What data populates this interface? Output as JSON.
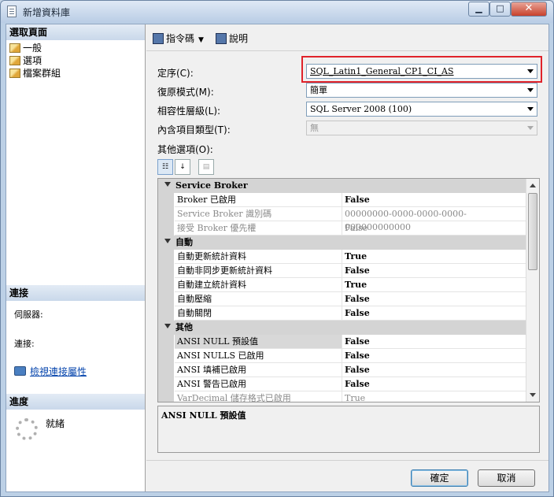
{
  "window": {
    "title": "新增資料庫"
  },
  "left": {
    "select_page_header": "選取頁面",
    "pages": [
      {
        "label": "一般"
      },
      {
        "label": "選項"
      },
      {
        "label": "檔案群組"
      }
    ],
    "connection_header": "連接",
    "server_label": "伺服器:",
    "connection_label": "連接:",
    "view_conn_link": "檢視連接屬性",
    "progress_header": "進度",
    "progress_status": "就緒"
  },
  "toolbar": {
    "script_label": "指令碼",
    "help_label": "說明"
  },
  "form": {
    "collation_label": "定序(C):",
    "collation_value": "SQL_Latin1_General_CP1_CI_AS",
    "recovery_label": "復原模式(M):",
    "recovery_value": "簡單",
    "compat_label": "相容性層級(L):",
    "compat_value": "SQL Server 2008 (100)",
    "containment_label": "內含項目類型(T):",
    "containment_value": "無",
    "other_label": "其他選項(O):"
  },
  "grid": {
    "rows": [
      {
        "type": "cat",
        "name": "Service Broker"
      },
      {
        "type": "prop",
        "name": "Broker 已啟用",
        "value": "False",
        "bold": true
      },
      {
        "type": "prop",
        "name": "Service Broker 識別碼",
        "value": "00000000-0000-0000-0000-000000000000",
        "dim": true
      },
      {
        "type": "prop",
        "name": "接受 Broker 優先權",
        "value": "False",
        "dim": true
      },
      {
        "type": "cat",
        "name": "自動"
      },
      {
        "type": "prop",
        "name": "自動更新統計資料",
        "value": "True",
        "bold": true
      },
      {
        "type": "prop",
        "name": "自動非同步更新統計資料",
        "value": "False",
        "bold": true
      },
      {
        "type": "prop",
        "name": "自動建立統計資料",
        "value": "True",
        "bold": true
      },
      {
        "type": "prop",
        "name": "自動壓縮",
        "value": "False",
        "bold": true
      },
      {
        "type": "prop",
        "name": "自動關閉",
        "value": "False",
        "bold": true
      },
      {
        "type": "cat",
        "name": "其他"
      },
      {
        "type": "prop",
        "name": "ANSI NULL 預設值",
        "value": "False",
        "bold": true,
        "selected": true
      },
      {
        "type": "prop",
        "name": "ANSI NULLS 已啟用",
        "value": "False",
        "bold": true
      },
      {
        "type": "prop",
        "name": "ANSI 填補已啟用",
        "value": "False",
        "bold": true
      },
      {
        "type": "prop",
        "name": "ANSI 警告已啟用",
        "value": "False",
        "bold": true
      },
      {
        "type": "prop",
        "name": "VarDecimal 儲存格式已啟用",
        "value": "True",
        "dim": true
      }
    ]
  },
  "description": "ANSI NULL 預設值",
  "footer": {
    "ok_label": "確定",
    "cancel_label": "取消"
  }
}
